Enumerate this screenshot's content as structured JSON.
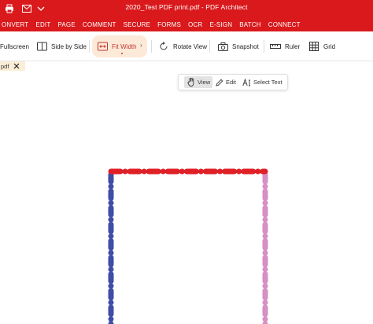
{
  "app": {
    "title": "2020_Test PDF print.pdf  -  PDF Architect"
  },
  "colors": {
    "brand": "#d9191c",
    "accent_bg": "#fde9d8",
    "accent_fg": "#c0392b",
    "border_top": "#e02027",
    "border_left": "#3f4da8",
    "border_right": "#d690c4"
  },
  "quick_access": {
    "print_icon": "printer-icon",
    "mail_icon": "mail-icon",
    "more_icon": "chevron-down-icon"
  },
  "ribbon": {
    "tabs": [
      {
        "label": "ONVERT"
      },
      {
        "label": "EDIT"
      },
      {
        "label": "PAGE"
      },
      {
        "label": "COMMENT"
      },
      {
        "label": "SECURE"
      },
      {
        "label": "FORMS"
      },
      {
        "label": "OCR"
      },
      {
        "label": "E-SIGN"
      },
      {
        "label": "BATCH"
      },
      {
        "label": "CONNECT"
      }
    ]
  },
  "toolbar": {
    "fullscreen": "Fullscreen",
    "side_by_side": "Side by Side",
    "fit_width": "Fit Width",
    "rotate_view": "Rotate View",
    "snapshot": "Snapshot",
    "ruler": "Ruler",
    "grid": "Grid"
  },
  "document_tab": {
    "label": "pdf"
  },
  "modebar": {
    "view": "View",
    "edit": "Edit",
    "select_text": "Select Text"
  }
}
